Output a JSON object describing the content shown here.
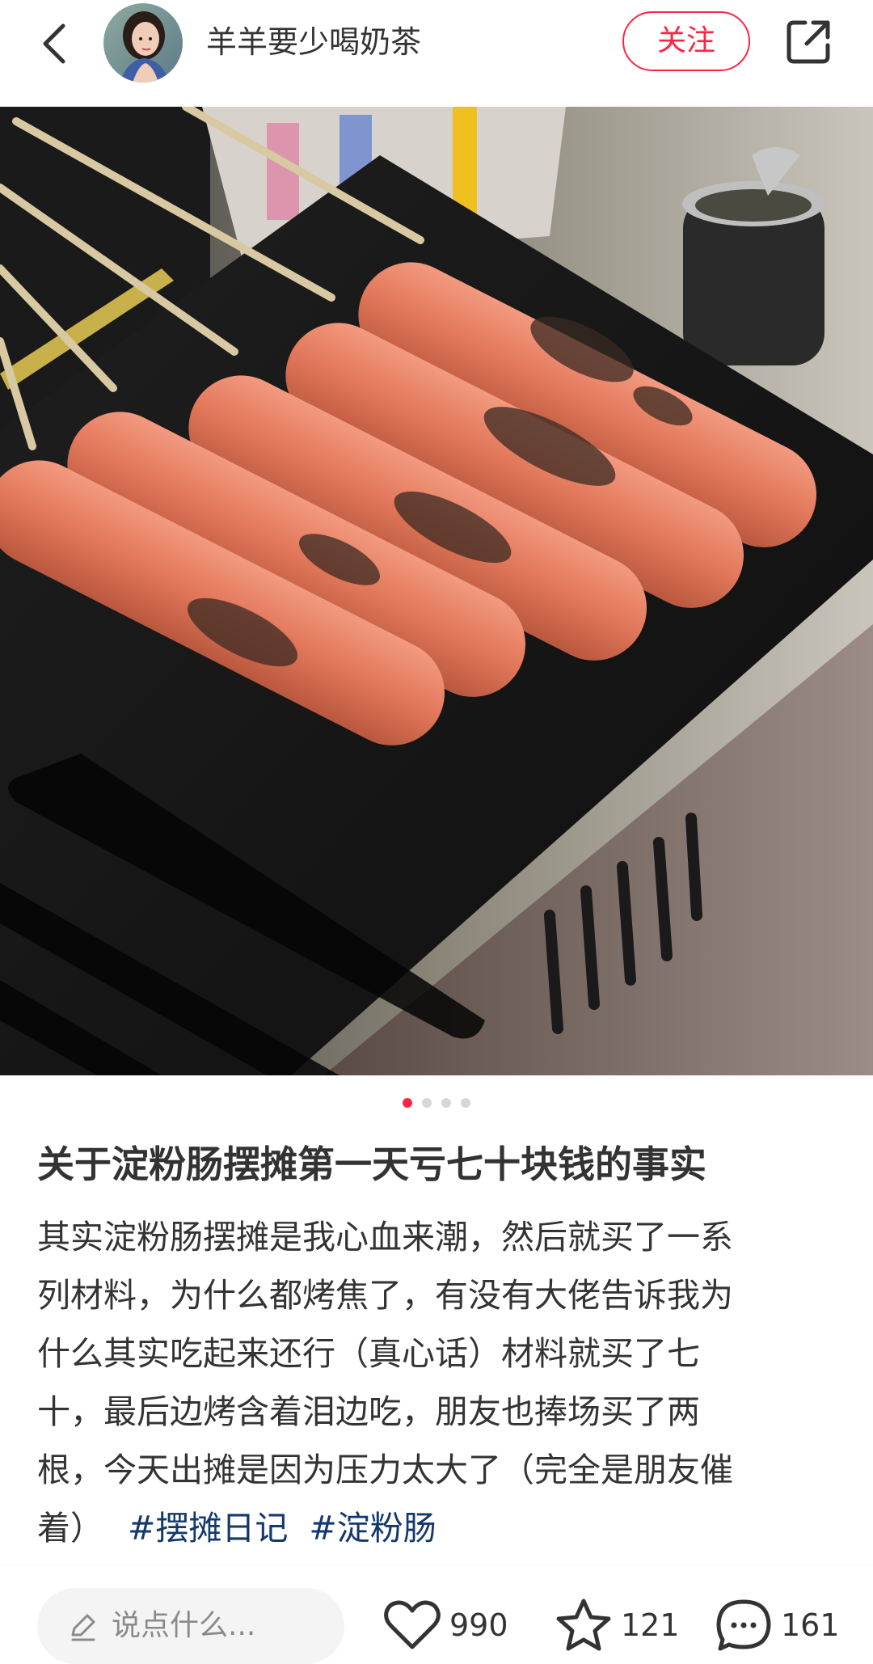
{
  "header": {
    "author_name": "羊羊要少喝奶茶",
    "follow_label": "关注",
    "icons": {
      "back": "chevron-left-icon",
      "share": "share-icon"
    }
  },
  "carousel": {
    "image_count": 4,
    "active_index": 0,
    "accent_color": "#ff2442"
  },
  "post": {
    "title": "关于淀粉肠摆摊第一天亏七十块钱的事实",
    "desc_lines": [
      "其实淀粉肠摆摊是我心血来潮，然后就买了一系",
      "列材料，为什么都烤焦了，有没有大佬告诉我为",
      "什么其实吃起来还行（真心话）材料就买了七",
      "十，最后边烤含着泪边吃，朋友也捧场买了两",
      "根，今天出摊是因为压力太大了（完全是朋友催",
      "着）"
    ],
    "tags": [
      "#摆摊日记",
      "#淀粉肠"
    ],
    "tag_color": "#13386c"
  },
  "bottom_bar": {
    "comment_placeholder": "说点什么...",
    "likes": "990",
    "collects": "121",
    "comments": "161"
  }
}
